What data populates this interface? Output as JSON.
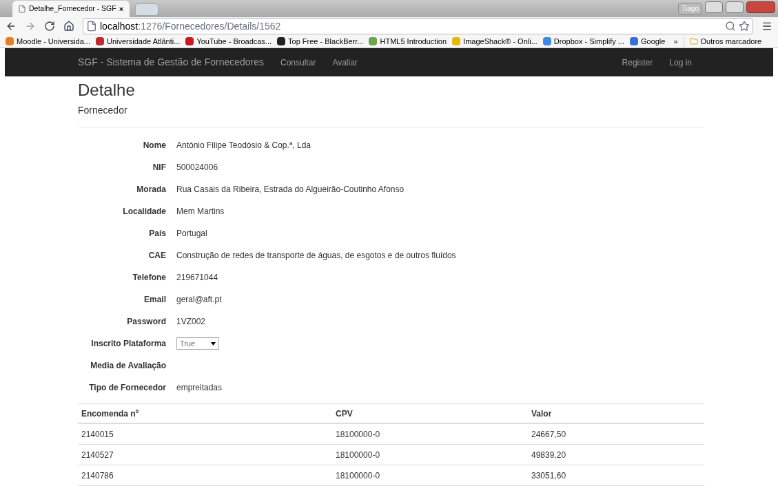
{
  "browser": {
    "user": "Tiago",
    "tabs": [
      {
        "title": "Detalhe_Fornecedor - SGF",
        "close": "×",
        "selected": true
      }
    ],
    "address": {
      "host": "localhost",
      "path": ":1276/Fornecedores/Details/1562"
    },
    "bookmarks": [
      {
        "label": "Moodle - Universida...",
        "color": "#e87e22"
      },
      {
        "label": "Universidade Atlânti...",
        "color": "#c0282d"
      },
      {
        "label": "YouTube - Broadcas...",
        "color": "#cc181e"
      },
      {
        "label": "Top Free - BlackBerr...",
        "color": "#222222"
      },
      {
        "label": "HTML5 Introduction",
        "color": "#6aa84f"
      },
      {
        "label": "ImageShack® - Onli...",
        "color": "#e6b800"
      },
      {
        "label": "Dropbox - Simplify ...",
        "color": "#3d8ae5"
      },
      {
        "label": "Google",
        "color": "#3b6fd8"
      }
    ],
    "more": "»",
    "other_bookmarks": "Outros marcadore"
  },
  "navbar": {
    "brand": "SGF - Sistema de Gestão de Fornecedores",
    "links": [
      "Consultar",
      "Avaliar"
    ],
    "right_links": [
      "Register",
      "Log in"
    ]
  },
  "page": {
    "title": "Detalhe",
    "subtitle": "Fornecedor",
    "fields": [
      {
        "kind": "text",
        "label": "Nome",
        "value": "António Filipe Teodósio & Cop.ª, Lda"
      },
      {
        "kind": "text",
        "label": "NIF",
        "value": "500024006"
      },
      {
        "kind": "text",
        "label": "Morada",
        "value": "Rua Casais da Ribeira, Estrada do Algueirão-Coutinho Afonso"
      },
      {
        "kind": "text",
        "label": "Localidade",
        "value": "Mem Martins"
      },
      {
        "kind": "text",
        "label": "País",
        "value": "Portugal"
      },
      {
        "kind": "text",
        "label": "CAE",
        "value": "Construção de redes de transporte de águas, de esgotos e de outros fluídos"
      },
      {
        "kind": "text",
        "label": "Telefone",
        "value": "219671044"
      },
      {
        "kind": "text",
        "label": "Email",
        "value": "geral@aft.pt"
      },
      {
        "kind": "text",
        "label": "Password",
        "value": "1VZ002"
      },
      {
        "kind": "select",
        "label": "Inscrito Plataforma",
        "value": "True",
        "disabled": true
      },
      {
        "kind": "text",
        "label": "Media de Avaliação"
      },
      {
        "kind": "text",
        "label": "Tipo de Fornecedor",
        "value": "empreitadas"
      }
    ],
    "table": {
      "columns": [
        "Encomenda nº",
        "CPV",
        "Valor"
      ],
      "rows": [
        [
          "2140015",
          "18100000-0",
          "24667,50"
        ],
        [
          "2140527",
          "18100000-0",
          "49839,20"
        ],
        [
          "2140786",
          "18100000-0",
          "33051,60"
        ]
      ]
    }
  }
}
